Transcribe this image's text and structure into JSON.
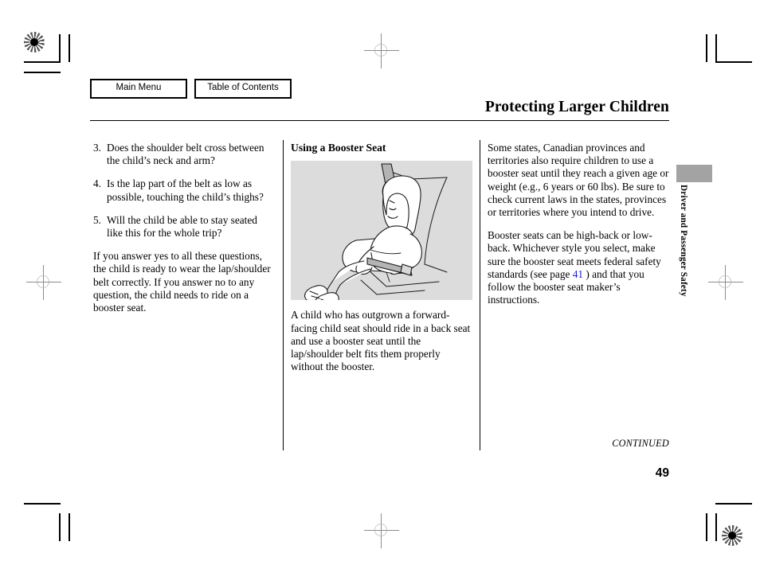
{
  "nav": {
    "main_menu": "Main Menu",
    "table_of_contents": "Table of Contents"
  },
  "header": {
    "title": "Protecting Larger Children"
  },
  "left_column": {
    "questions": [
      {
        "num": "3.",
        "text": "Does the shoulder belt cross between the child’s neck and arm?"
      },
      {
        "num": "4.",
        "text": "Is the lap part of the belt as low as possible, touching the child’s thighs?"
      },
      {
        "num": "5.",
        "text": "Will the child be able to stay seated like this for the whole trip?"
      }
    ],
    "paragraph": "If you answer yes to all these questions, the child is ready to wear the lap/shoulder belt correctly. If you answer no to any question, the child needs to ride on a booster seat."
  },
  "middle_column": {
    "heading": "Using a Booster Seat",
    "figure_alt": "child-in-booster-seat-illustration",
    "paragraph": "A child who has outgrown a forward-facing child seat should ride in a back seat and use a booster seat until the lap/shoulder belt fits them properly without the booster."
  },
  "right_column": {
    "paragraph_1": "Some states, Canadian provinces and territories also require children to use a booster seat until they reach a given age or weight (e.g., 6 years or 60 lbs). Be sure to check current laws in the states, provinces or territories where you intend to drive.",
    "paragraph_2_before": "Booster seats can be high-back or low-back. Whichever style you select, make sure the booster seat meets federal safety standards (see page ",
    "page_ref": "41",
    "paragraph_2_after": " ) and that you follow the booster seat maker’s instructions."
  },
  "edge_tab": {
    "label": "Driver and Passenger Safety"
  },
  "footer": {
    "continued": "CONTINUED",
    "page_number": "49"
  },
  "colors": {
    "link": "#2222cc",
    "tab_gray": "#a3a3a3",
    "figure_bg": "#dcdcdc"
  }
}
